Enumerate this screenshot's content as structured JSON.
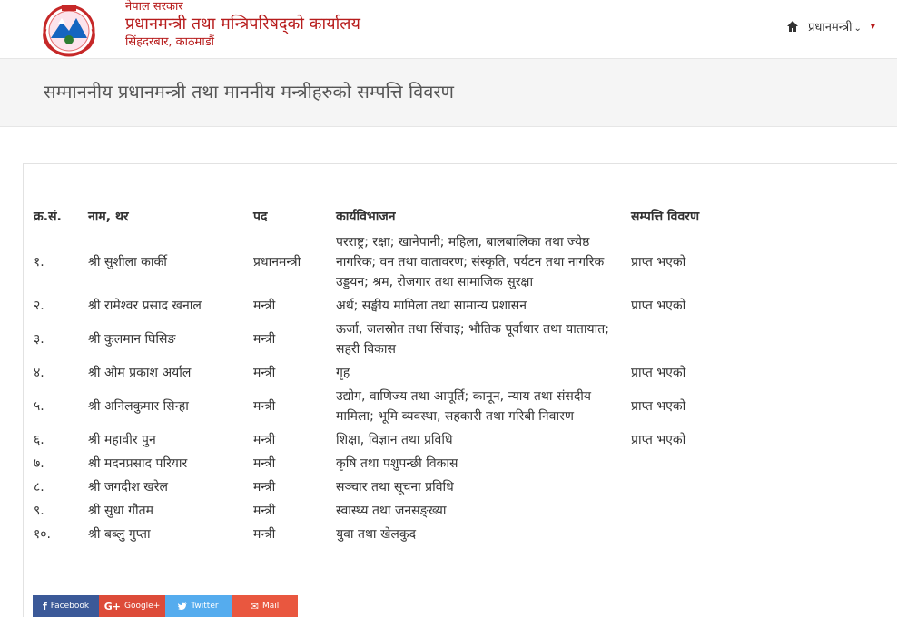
{
  "header": {
    "org_line1": "नेपाल सरकार",
    "org_line2": "प्रधानमन्त्री तथा मन्त्रिपरिषद्को कार्यालय",
    "org_line3": "सिंहदरबार, काठमाडौं",
    "nav_item": "प्रधानमन्त्री",
    "nav_chevron": "⌄",
    "nav_cut": "▾"
  },
  "page_title": "सम्माननीय प्रधानमन्त्री तथा माननीय मन्त्रीहरुको सम्पत्ति विवरण",
  "table": {
    "headers": [
      "क्र.सं.",
      "नाम, थर",
      "पद",
      "कार्यविभाजन",
      "सम्पत्ति विवरण"
    ],
    "rows": [
      [
        "१.",
        "श्री सुशीला कार्की",
        "प्रधानमन्त्री",
        "परराष्ट्र; रक्षा; खानेपानी; महिला, बालबालिका तथा ज्येष्ठ नागरिक; वन तथा वातावरण; संस्कृति, पर्यटन तथा नागरिक उड्डयन; श्रम, रोजगार तथा सामाजिक सुरक्षा",
        "प्राप्त भएको"
      ],
      [
        "२.",
        "श्री रामेश्वर प्रसाद खनाल",
        "मन्त्री",
        "अर्थ; सङ्घीय मामिला तथा सामान्य प्रशासन",
        "प्राप्त भएको"
      ],
      [
        "३.",
        "श्री कुलमान घिसिङ",
        "मन्त्री",
        "ऊर्जा, जलस्रोत तथा सिंचाइ; भौतिक पूर्वाधार तथा यातायात; सहरी विकास",
        ""
      ],
      [
        "४.",
        "श्री ओम प्रकाश अर्याल",
        "मन्त्री",
        "गृह",
        "प्राप्त भएको"
      ],
      [
        "५.",
        "श्री अनिलकुमार सिन्हा",
        "मन्त्री",
        "उद्योग, वाणिज्य तथा आपूर्ति; कानून, न्याय तथा संसदीय मामिला; भूमि व्यवस्था, सहकारी तथा गरिबी निवारण",
        "प्राप्त भएको"
      ],
      [
        "६.",
        "श्री महावीर पुन",
        "मन्त्री",
        "शिक्षा, विज्ञान तथा प्रविधि",
        "प्राप्त भएको"
      ],
      [
        "७.",
        "श्री मदनप्रसाद परियार",
        "मन्त्री",
        "कृषि तथा पशुपन्छी विकास",
        ""
      ],
      [
        "८.",
        "श्री जगदीश खरेल",
        "मन्त्री",
        "सञ्चार तथा सूचना प्रविधि",
        ""
      ],
      [
        "९.",
        "श्री सुधा गौतम",
        "मन्त्री",
        "स्वास्थ्य तथा जनसङ्ख्या",
        ""
      ],
      [
        "१०.",
        "श्री बब्लु गुप्ता",
        "मन्त्री",
        "युवा तथा खेलकुद",
        ""
      ]
    ]
  },
  "share": {
    "facebook": "Facebook",
    "facebook_icon": "f",
    "google": "Google+",
    "google_icon": "G+",
    "twitter": "Twitter",
    "twitter_icon": "🐦",
    "mail": "Mail",
    "mail_icon": "✉"
  },
  "colors": {
    "brand_red": "#b71c1c",
    "facebook": "#3b5998",
    "google": "#dd4b39",
    "twitter": "#55acee",
    "mail": "#e9573f"
  }
}
